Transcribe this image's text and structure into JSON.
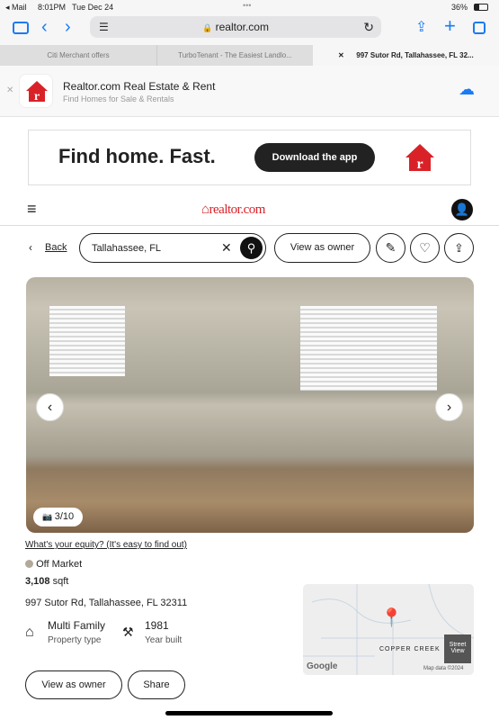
{
  "status": {
    "back_app": "◂ Mail",
    "time": "8:01PM",
    "date": "Tue Dec 24",
    "battery": "36%"
  },
  "browser": {
    "url": "realtor.com",
    "tabs": [
      "Citi Merchant offers",
      "TurboTenant - The Easiest Landlo...",
      "997 Sutor Rd, Tallahassee, FL 32..."
    ]
  },
  "app_banner": {
    "title": "Realtor.com Real Estate & Rent",
    "subtitle": "Find Homes for Sale & Rentals"
  },
  "ad": {
    "headline": "Find home. Fast.",
    "cta": "Download the app"
  },
  "site": {
    "logo": "realtor.com"
  },
  "search": {
    "back": "Back",
    "value": "Tallahassee, FL",
    "view_as_owner": "View as owner"
  },
  "photo": {
    "counter": "3/10"
  },
  "listing": {
    "equity_link": "What's your equity? (It's easy to find out)",
    "status": "Off Market",
    "status_color": "#b3a99b",
    "sqft_value": "3,108",
    "sqft_unit": "sqft",
    "address": "997 Sutor Rd, Tallahassee, FL 32311",
    "property_type": "Multi Family",
    "property_type_label": "Property type",
    "year_built": "1981",
    "year_built_label": "Year built"
  },
  "map": {
    "area_label": "COPPER CREEK",
    "street_view": "Street View",
    "google": "Google",
    "attribution": "Map data ©2024"
  },
  "actions": {
    "view_as_owner": "View as owner",
    "share": "Share"
  }
}
